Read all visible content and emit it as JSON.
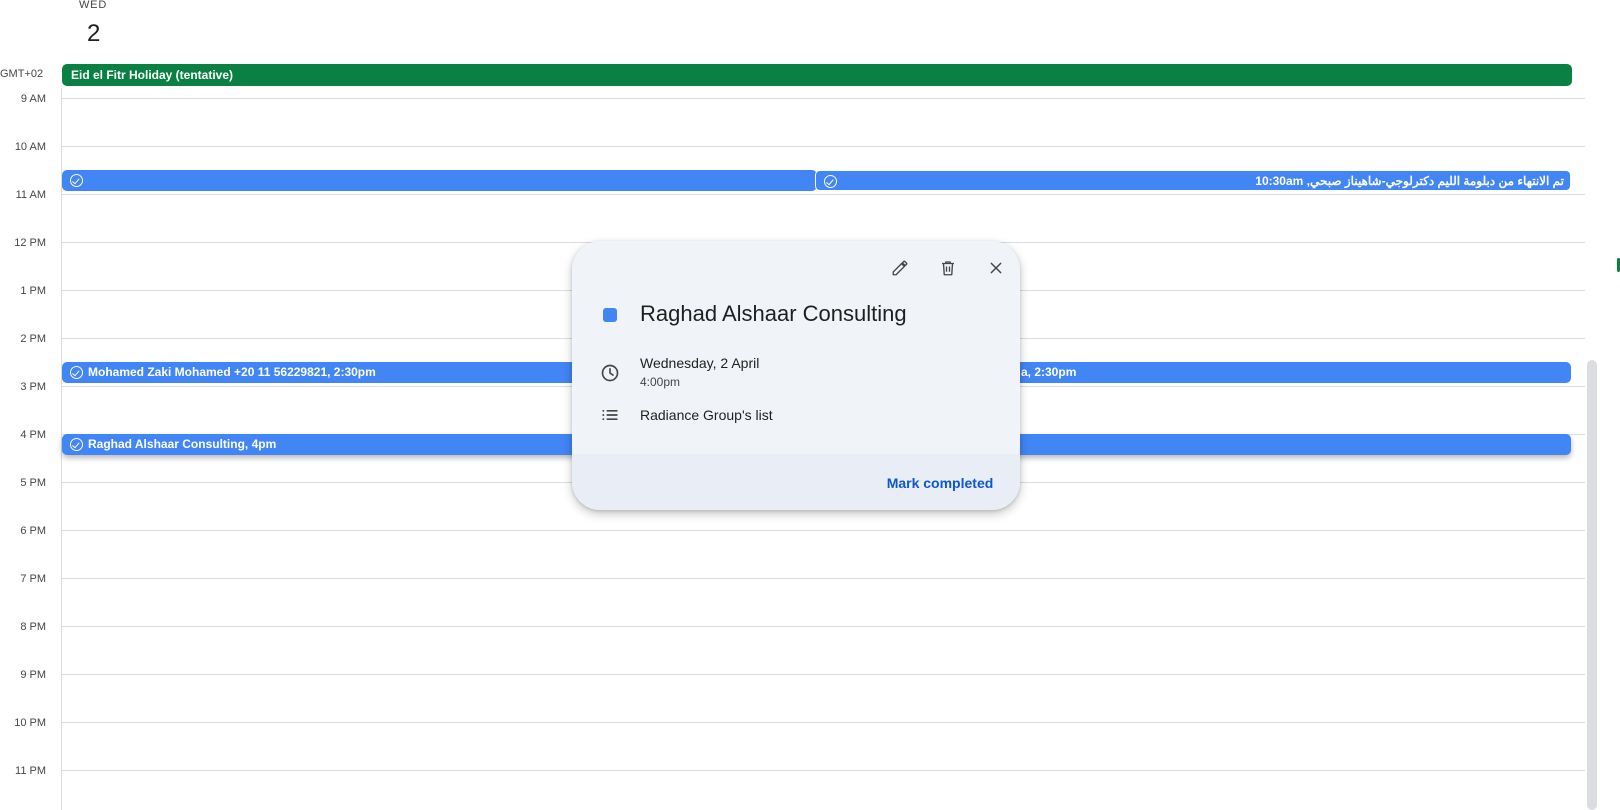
{
  "day_header": {
    "day_name": "WED",
    "day_number": "2"
  },
  "timezone": "GMT+02",
  "allday_event": {
    "title": "Eid el Fitr Holiday (tentative)",
    "color": "#0b8043"
  },
  "hours": [
    "9 AM",
    "10 AM",
    "11 AM",
    "12 PM",
    "1 PM",
    "2 PM",
    "3 PM",
    "4 PM",
    "5 PM",
    "6 PM",
    "7 PM",
    "8 PM",
    "9 PM",
    "10 PM",
    "11 PM"
  ],
  "events": [
    {
      "text": "",
      "icon": "task-check-icon"
    },
    {
      "text": "تم الانتهاء من دبلومة الليم دكترلوجي-شاهيناز صبحي, 10:30am",
      "icon": "task-check-icon"
    },
    {
      "text": "Mohamed Zaki Mohamed +20 11 56229821, 2:30pm",
      "icon": "task-check-icon"
    },
    {
      "text": "a, 2:30pm",
      "icon": ""
    },
    {
      "text": "Raghad Alshaar Consulting, 4pm",
      "icon": "task-check-icon"
    }
  ],
  "event_color": "#4285f4",
  "popup": {
    "title": "Raghad Alshaar Consulting",
    "date": "Wednesday, 2 April",
    "time": "4:00pm",
    "list": "Radiance Group's list",
    "action": "Mark completed",
    "icons": [
      "edit-icon",
      "delete-icon",
      "close-icon",
      "clock-icon",
      "list-icon"
    ]
  }
}
